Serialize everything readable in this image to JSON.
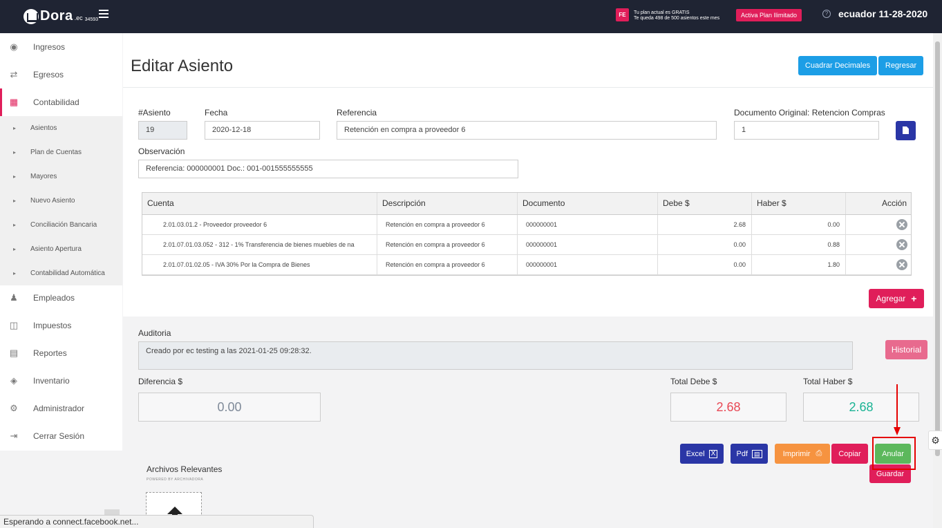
{
  "topbar": {
    "logo_text": "Dora",
    "logo_suffix": ".ec",
    "logo_number": "34593",
    "fe_badge": "FE",
    "plan_line1": "Tu plan actual es GRATIS",
    "plan_line2": "Te queda 498 de 500 asientos este mes",
    "plan_button": "Activa Plan Ilimitado",
    "date_label": "ecuador 11-28-2020"
  },
  "sidebar": {
    "items": [
      {
        "label": "Ingresos",
        "icon": "piggy-bank-icon"
      },
      {
        "label": "Egresos",
        "icon": "transfer-icon"
      },
      {
        "label": "Contabilidad",
        "icon": "calculator-icon"
      },
      {
        "label": "Empleados",
        "icon": "people-icon"
      },
      {
        "label": "Impuestos",
        "icon": "tax-icon"
      },
      {
        "label": "Reportes",
        "icon": "report-icon"
      },
      {
        "label": "Inventario",
        "icon": "boxes-icon"
      },
      {
        "label": "Administrador",
        "icon": "gear-icon"
      },
      {
        "label": "Cerrar Sesión",
        "icon": "logout-icon"
      }
    ],
    "sub_items": [
      "Asientos",
      "Plan de Cuentas",
      "Mayores",
      "Nuevo Asiento",
      "Conciliación Bancaria",
      "Asiento Apertura",
      "Contabilidad Automática"
    ]
  },
  "page": {
    "title": "Editar Asiento",
    "btn_cuadrar": "Cuadrar Decimales",
    "btn_regresar": "Regresar"
  },
  "form": {
    "asiento_label": "#Asiento",
    "asiento_value": "19",
    "fecha_label": "Fecha",
    "fecha_value": "2020-12-18",
    "referencia_label": "Referencia",
    "referencia_value": "Retención en compra a proveedor 6",
    "doc_original_label": "Documento Original: Retencion Compras",
    "doc_original_value": "1",
    "observacion_label": "Observación",
    "observacion_value": "Referencia: 000000001 Doc.: 001-001555555555"
  },
  "table": {
    "headers": [
      "Cuenta",
      "Descripción",
      "Documento",
      "Debe $",
      "Haber $",
      "Acción"
    ],
    "rows": [
      {
        "cuenta": "2.01.03.01.2 - Proveedor proveedor 6",
        "descripcion": "Retención en compra a proveedor 6",
        "documento": "000000001",
        "debe": "2.68",
        "haber": "0.00"
      },
      {
        "cuenta": "2.01.07.01.03.052 - 312 - 1% Transferencia de bienes muebles de na",
        "descripcion": "Retención en compra a proveedor 6",
        "documento": "000000001",
        "debe": "0.00",
        "haber": "0.88"
      },
      {
        "cuenta": "2.01.07.01.02.05 - IVA 30% Por la Compra de Bienes",
        "descripcion": "Retención en compra a proveedor 6",
        "documento": "000000001",
        "debe": "0.00",
        "haber": "1.80"
      }
    ],
    "add_button": "Agregar"
  },
  "auditoria": {
    "label": "Auditoria",
    "text": "Creado por ec testing a las 2021-01-25 09:28:32.",
    "historial_button": "Historial"
  },
  "totals": {
    "diferencia_label": "Diferencia $",
    "diferencia_value": "0.00",
    "debe_label": "Total Debe $",
    "debe_value": "2.68",
    "haber_label": "Total Haber $",
    "haber_value": "2.68",
    "color_debe": "#e84855",
    "color_haber": "#1ab394",
    "color_diferencia": "#7f8a99"
  },
  "actions": {
    "excel": "Excel",
    "pdf": "Pdf",
    "imprimir": "Imprimir",
    "copiar": "Copiar",
    "anular": "Anular",
    "guardar": "Guardar"
  },
  "files": {
    "title": "Archivos Relevantes",
    "subtitle": "POWERED BY ARCHIVADORA"
  },
  "status_bar": "Esperando a connect.facebook.net..."
}
